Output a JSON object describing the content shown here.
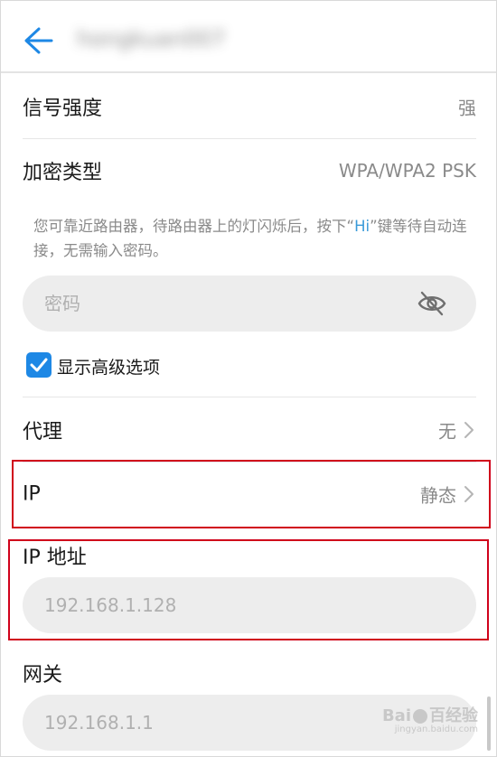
{
  "header": {
    "ssid": "hongkuan007"
  },
  "signal": {
    "label": "信号强度",
    "value": "强"
  },
  "security": {
    "label": "加密类型",
    "value": "WPA/WPA2 PSK"
  },
  "hint": {
    "prefix": "您可靠近路由器，待路由器上的灯闪烁后，按下“",
    "hi": "Hi",
    "suffix": "”键等待自动连接，无需输入密码。"
  },
  "password": {
    "placeholder": "密码"
  },
  "advanced": {
    "label": "显示高级选项",
    "checked": true
  },
  "proxy": {
    "label": "代理",
    "value": "无"
  },
  "ip_mode": {
    "label": "IP",
    "value": "静态"
  },
  "ip_address": {
    "label": "IP 地址",
    "placeholder": "192.168.1.128"
  },
  "gateway": {
    "label": "网关",
    "placeholder": "192.168.1.1"
  },
  "watermark": {
    "brand": "Bai",
    "brand2": "百经验",
    "url": "jingyan.baidu.com"
  },
  "colors": {
    "accent": "#1e88e5",
    "highlight": "#d0021b",
    "link": "#3a9ad9"
  }
}
